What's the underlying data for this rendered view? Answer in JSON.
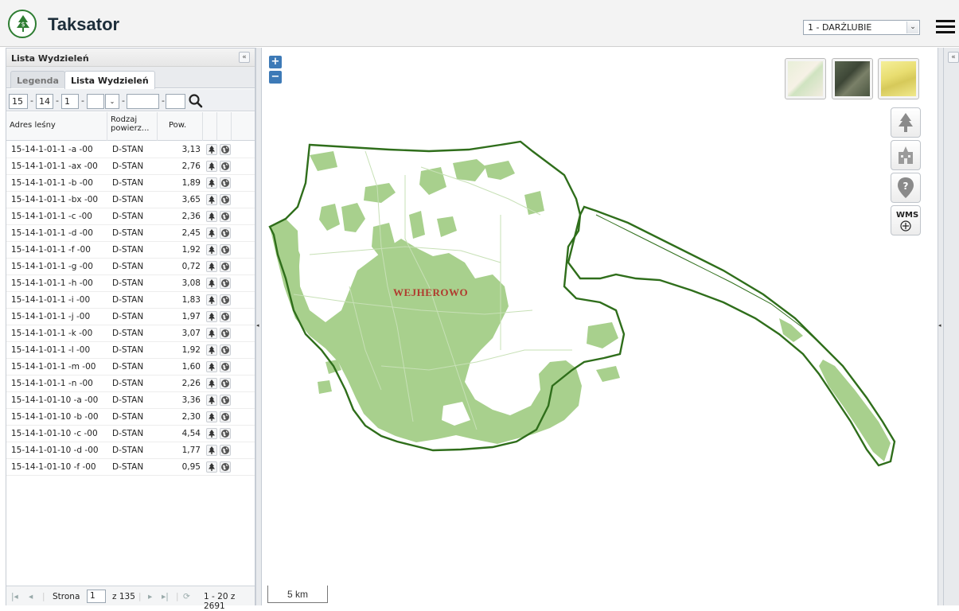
{
  "app": {
    "title": "Taksator"
  },
  "header": {
    "district_select": "1 - DARŻLUBIE"
  },
  "panel": {
    "title": "Lista Wydzieleń",
    "tabs": [
      "Legenda",
      "Lista Wydzieleń"
    ],
    "filters": {
      "f1": "15",
      "f2": "14",
      "f3": "1",
      "f4": "",
      "f5": "",
      "f6": "",
      "f7": ""
    },
    "columns": [
      "Adres leśny",
      "Rodzaj powierz...",
      "Pow."
    ],
    "rows": [
      {
        "addr": "15-14-1-01-1 -a -00",
        "type": "D-STAN",
        "area": "3,13"
      },
      {
        "addr": "15-14-1-01-1 -ax -00",
        "type": "D-STAN",
        "area": "2,76"
      },
      {
        "addr": "15-14-1-01-1 -b -00",
        "type": "D-STAN",
        "area": "1,89"
      },
      {
        "addr": "15-14-1-01-1 -bx -00",
        "type": "D-STAN",
        "area": "3,65"
      },
      {
        "addr": "15-14-1-01-1 -c -00",
        "type": "D-STAN",
        "area": "2,36"
      },
      {
        "addr": "15-14-1-01-1 -d -00",
        "type": "D-STAN",
        "area": "2,45"
      },
      {
        "addr": "15-14-1-01-1 -f -00",
        "type": "D-STAN",
        "area": "1,92"
      },
      {
        "addr": "15-14-1-01-1 -g -00",
        "type": "D-STAN",
        "area": "0,72"
      },
      {
        "addr": "15-14-1-01-1 -h -00",
        "type": "D-STAN",
        "area": "3,08"
      },
      {
        "addr": "15-14-1-01-1 -i -00",
        "type": "D-STAN",
        "area": "1,83"
      },
      {
        "addr": "15-14-1-01-1 -j -00",
        "type": "D-STAN",
        "area": "1,97"
      },
      {
        "addr": "15-14-1-01-1 -k -00",
        "type": "D-STAN",
        "area": "3,07"
      },
      {
        "addr": "15-14-1-01-1 -l -00",
        "type": "D-STAN",
        "area": "1,92"
      },
      {
        "addr": "15-14-1-01-1 -m -00",
        "type": "D-STAN",
        "area": "1,60"
      },
      {
        "addr": "15-14-1-01-1 -n -00",
        "type": "D-STAN",
        "area": "2,26"
      },
      {
        "addr": "15-14-1-01-10 -a -00",
        "type": "D-STAN",
        "area": "3,36"
      },
      {
        "addr": "15-14-1-01-10 -b -00",
        "type": "D-STAN",
        "area": "2,30"
      },
      {
        "addr": "15-14-1-01-10 -c -00",
        "type": "D-STAN",
        "area": "4,54"
      },
      {
        "addr": "15-14-1-01-10 -d -00",
        "type": "D-STAN",
        "area": "1,77"
      },
      {
        "addr": "15-14-1-01-10 -f -00",
        "type": "D-STAN",
        "area": "0,95"
      }
    ],
    "pager": {
      "page_label": "Strona",
      "page": "1",
      "of_total": "z 135",
      "range": "1 - 20 z 2691"
    }
  },
  "map": {
    "zoom_in": "+",
    "zoom_out": "−",
    "wms_label": "WMS",
    "city_label": "WEJHEROWO",
    "scale_label": "5 km",
    "icons": [
      "tree-icon",
      "building-icon",
      "info-marker-icon",
      "wms-add-icon"
    ],
    "colors": {
      "forest": "#a8d08d",
      "boundary": "#2f6e1b",
      "accent": "#3d7ab7"
    }
  }
}
